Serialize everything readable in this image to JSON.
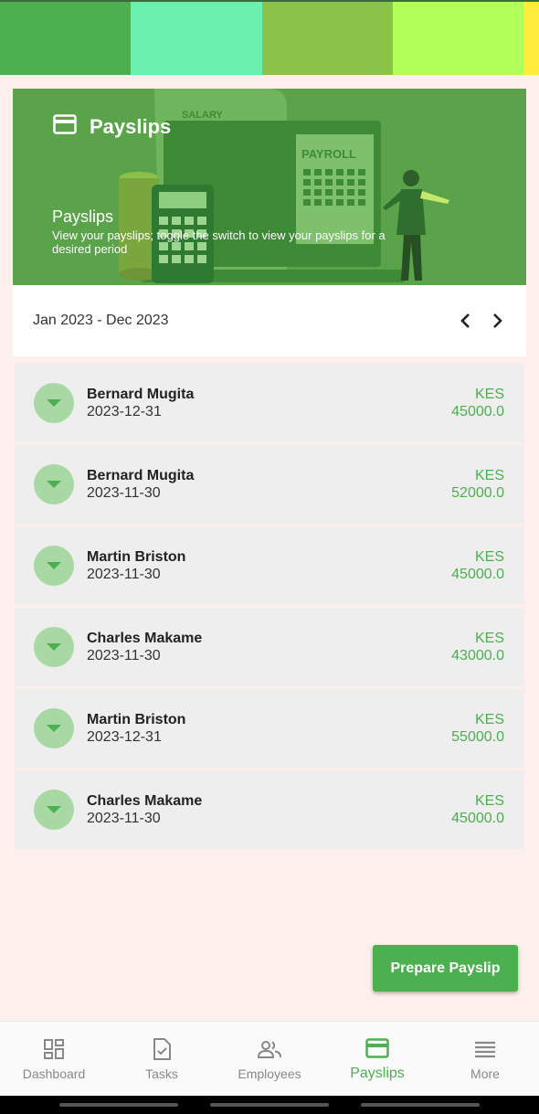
{
  "top_strip": {
    "colors": [
      "#4caf50",
      "#69f0ae",
      "#8bc34a",
      "#b2ff59",
      "#ffeb3b"
    ]
  },
  "banner": {
    "title": "Payslips",
    "icon": "card-icon",
    "illustration_labels": {
      "salary": "SALARY",
      "payroll": "PAYROLL"
    },
    "subtitle": "Payslips",
    "description": "View your payslips; toggle the switch to view your payslips for a desired period"
  },
  "period": {
    "label": "Jan 2023 - Dec 2023",
    "prev_icon": "chevron-left-icon",
    "next_icon": "chevron-right-icon"
  },
  "payslips": [
    {
      "name": "Bernard Mugita",
      "date": "2023-12-31",
      "currency": "KES",
      "amount": "45000.0"
    },
    {
      "name": "Bernard Mugita",
      "date": "2023-11-30",
      "currency": "KES",
      "amount": "52000.0"
    },
    {
      "name": "Martin Briston",
      "date": "2023-11-30",
      "currency": "KES",
      "amount": "45000.0"
    },
    {
      "name": "Charles Makame",
      "date": "2023-11-30",
      "currency": "KES",
      "amount": "43000.0"
    },
    {
      "name": "Martin Briston",
      "date": "2023-12-31",
      "currency": "KES",
      "amount": "55000.0"
    },
    {
      "name": "Charles Makame",
      "date": "2023-11-30",
      "currency": "KES",
      "amount": "45000.0"
    }
  ],
  "prepare_button": "Prepare Payslip",
  "bottom_nav": {
    "items": [
      {
        "label": "Dashboard",
        "icon": "dashboard-icon"
      },
      {
        "label": "Tasks",
        "icon": "tasks-icon"
      },
      {
        "label": "Employees",
        "icon": "employees-icon"
      },
      {
        "label": "Payslips",
        "icon": "card-icon",
        "active": true
      },
      {
        "label": "More",
        "icon": "menu-icon"
      }
    ]
  },
  "colors": {
    "accent": "#4caf50",
    "banner": "#5aa34a",
    "row_bg": "#eeeeee",
    "page_bg": "#fdf0ec"
  }
}
